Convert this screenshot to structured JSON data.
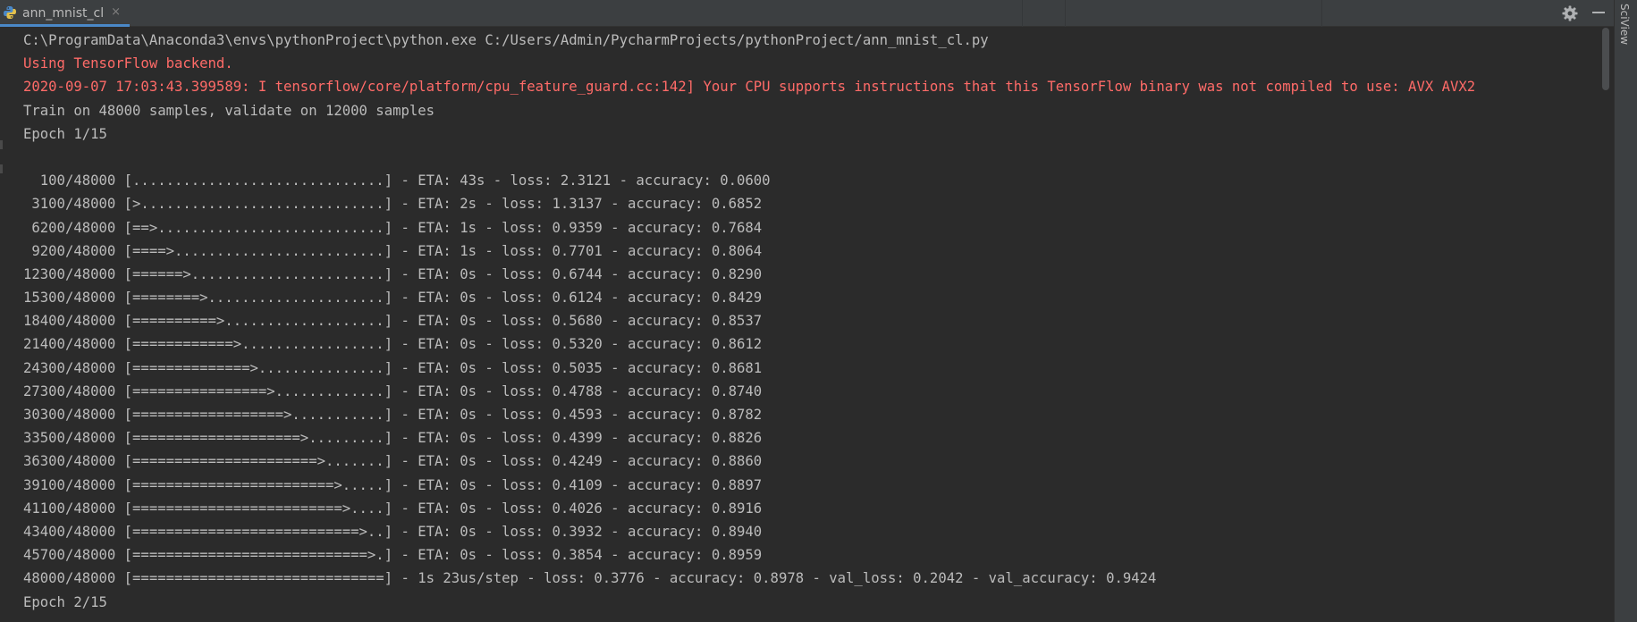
{
  "tab": {
    "label": "ann_mnist_cl",
    "close": "×"
  },
  "side_panel": {
    "label": "SciView"
  },
  "console": {
    "lines": [
      {
        "text": "C:\\ProgramData\\Anaconda3\\envs\\pythonProject\\python.exe C:/Users/Admin/PycharmProjects/pythonProject/ann_mnist_cl.py",
        "style": "normal"
      },
      {
        "text": "Using TensorFlow backend.",
        "style": "err"
      },
      {
        "text": "2020-09-07 17:03:43.399589: I tensorflow/core/platform/cpu_feature_guard.cc:142] Your CPU supports instructions that this TensorFlow binary was not compiled to use: AVX AVX2",
        "style": "err"
      },
      {
        "text": "Train on 48000 samples, validate on 12000 samples",
        "style": "normal"
      },
      {
        "text": "Epoch 1/15",
        "style": "normal"
      },
      {
        "text": "",
        "style": "normal"
      },
      {
        "text": "  100/48000 [..............................] - ETA: 43s - loss: 2.3121 - accuracy: 0.0600",
        "style": "normal"
      },
      {
        "text": " 3100/48000 [>.............................] - ETA: 2s - loss: 1.3137 - accuracy: 0.6852",
        "style": "normal"
      },
      {
        "text": " 6200/48000 [==>...........................] - ETA: 1s - loss: 0.9359 - accuracy: 0.7684",
        "style": "normal"
      },
      {
        "text": " 9200/48000 [====>.........................] - ETA: 1s - loss: 0.7701 - accuracy: 0.8064",
        "style": "normal"
      },
      {
        "text": "12300/48000 [======>.......................] - ETA: 0s - loss: 0.6744 - accuracy: 0.8290",
        "style": "normal"
      },
      {
        "text": "15300/48000 [========>.....................] - ETA: 0s - loss: 0.6124 - accuracy: 0.8429",
        "style": "normal"
      },
      {
        "text": "18400/48000 [==========>...................] - ETA: 0s - loss: 0.5680 - accuracy: 0.8537",
        "style": "normal"
      },
      {
        "text": "21400/48000 [============>.................] - ETA: 0s - loss: 0.5320 - accuracy: 0.8612",
        "style": "normal"
      },
      {
        "text": "24300/48000 [==============>...............] - ETA: 0s - loss: 0.5035 - accuracy: 0.8681",
        "style": "normal"
      },
      {
        "text": "27300/48000 [================>.............] - ETA: 0s - loss: 0.4788 - accuracy: 0.8740",
        "style": "normal"
      },
      {
        "text": "30300/48000 [==================>...........] - ETA: 0s - loss: 0.4593 - accuracy: 0.8782",
        "style": "normal"
      },
      {
        "text": "33500/48000 [====================>.........] - ETA: 0s - loss: 0.4399 - accuracy: 0.8826",
        "style": "normal"
      },
      {
        "text": "36300/48000 [======================>.......] - ETA: 0s - loss: 0.4249 - accuracy: 0.8860",
        "style": "normal"
      },
      {
        "text": "39100/48000 [========================>.....] - ETA: 0s - loss: 0.4109 - accuracy: 0.8897",
        "style": "normal"
      },
      {
        "text": "41100/48000 [=========================>....] - ETA: 0s - loss: 0.4026 - accuracy: 0.8916",
        "style": "normal"
      },
      {
        "text": "43400/48000 [===========================>..] - ETA: 0s - loss: 0.3932 - accuracy: 0.8940",
        "style": "normal"
      },
      {
        "text": "45700/48000 [============================>.] - ETA: 0s - loss: 0.3854 - accuracy: 0.8959",
        "style": "normal"
      },
      {
        "text": "48000/48000 [==============================] - 1s 23us/step - loss: 0.3776 - accuracy: 0.8978 - val_loss: 0.2042 - val_accuracy: 0.9424",
        "style": "normal"
      },
      {
        "text": "Epoch 2/15",
        "style": "normal"
      }
    ]
  },
  "colors": {
    "background": "#2b2b2b",
    "text": "#bbbbbb",
    "error": "#ff6b68",
    "accent": "#4a88c7"
  },
  "icons": {
    "tab": "python-file-icon",
    "settings": "gear-icon",
    "hide": "minimize-icon"
  }
}
